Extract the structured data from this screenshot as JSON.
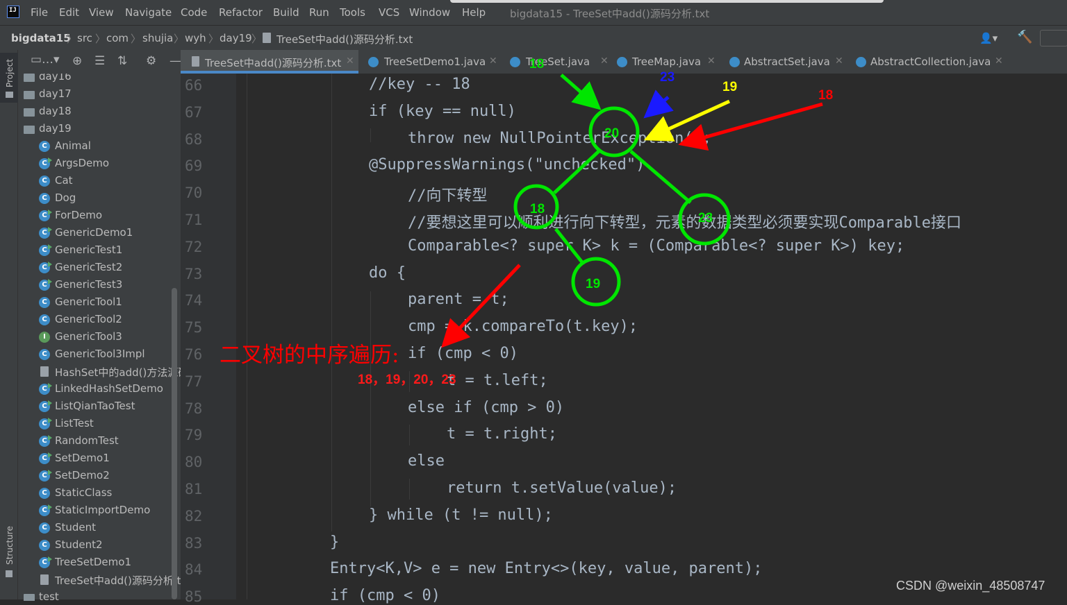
{
  "window": {
    "title": "bigdata15 - TreeSet中add()源码分析.txt",
    "menu": [
      "File",
      "Edit",
      "View",
      "Navigate",
      "Code",
      "Refactor",
      "Build",
      "Run",
      "Tools",
      "VCS",
      "Window",
      "Help"
    ]
  },
  "breadcrumb": [
    "bigdata15",
    "src",
    "com",
    "shujia",
    "wyh",
    "day19",
    "TreeSet中add()源码分析.txt"
  ],
  "tool_windows": {
    "project": "Project",
    "structure": "Structure"
  },
  "project_tree": {
    "folders": [
      "day16",
      "day17",
      "day18",
      "day19"
    ],
    "items": [
      {
        "label": "Animal",
        "kind": "class"
      },
      {
        "label": "ArgsDemo",
        "kind": "class-run"
      },
      {
        "label": "Cat",
        "kind": "class"
      },
      {
        "label": "Dog",
        "kind": "class"
      },
      {
        "label": "ForDemo",
        "kind": "class-run"
      },
      {
        "label": "GenericDemo1",
        "kind": "class-run"
      },
      {
        "label": "GenericTest1",
        "kind": "class-run"
      },
      {
        "label": "GenericTest2",
        "kind": "class-run"
      },
      {
        "label": "GenericTest3",
        "kind": "class-run"
      },
      {
        "label": "GenericTool1",
        "kind": "class"
      },
      {
        "label": "GenericTool2",
        "kind": "class"
      },
      {
        "label": "GenericTool3",
        "kind": "interface"
      },
      {
        "label": "GenericTool3Impl",
        "kind": "class"
      },
      {
        "label": "HashSet中的add()方法源码",
        "kind": "file"
      },
      {
        "label": "LinkedHashSetDemo",
        "kind": "class-run"
      },
      {
        "label": "ListQianTaoTest",
        "kind": "class-run"
      },
      {
        "label": "ListTest",
        "kind": "class-run"
      },
      {
        "label": "RandomTest",
        "kind": "class-run"
      },
      {
        "label": "SetDemo1",
        "kind": "class-run"
      },
      {
        "label": "SetDemo2",
        "kind": "class-run"
      },
      {
        "label": "StaticClass",
        "kind": "class"
      },
      {
        "label": "StaticImportDemo",
        "kind": "class-run"
      },
      {
        "label": "Student",
        "kind": "class"
      },
      {
        "label": "Student2",
        "kind": "class"
      },
      {
        "label": "TreeSetDemo1",
        "kind": "class-run"
      },
      {
        "label": "TreeSet中add()源码分析.t",
        "kind": "file"
      }
    ],
    "trailing_folder": "test"
  },
  "tabs": [
    {
      "label": "TreeSet中add()源码分析.txt",
      "icon": "text-file-icon",
      "active": true
    },
    {
      "label": "TreeSetDemo1.java",
      "icon": "class-icon"
    },
    {
      "label": "TreeSet.java",
      "icon": "class-icon"
    },
    {
      "label": "TreeMap.java",
      "icon": "class-icon"
    },
    {
      "label": "AbstractSet.java",
      "icon": "class-icon"
    },
    {
      "label": "AbstractCollection.java",
      "icon": "class-icon"
    }
  ],
  "code": {
    "line_numbers": [
      "66",
      "67",
      "68",
      "69",
      "70",
      "71",
      "72",
      "73",
      "74",
      "75",
      "76",
      "77",
      "78",
      "79",
      "80",
      "81",
      "82",
      "83",
      "84",
      "85"
    ],
    "lines": [
      "//key -- 18",
      "if (key == null)",
      "throw new NullPointerException();",
      "@SuppressWarnings(\"unchecked\")",
      "//向下转型",
      "//要想这里可以顺利进行向下转型，元素的数据类型必须要实现Comparable接口",
      "Comparable<? super K> k = (Comparable<? super K>) key;",
      "do {",
      "parent = t;",
      "cmp = k.compareTo(t.key);",
      "if (cmp < 0)",
      "t = t.left;",
      "else if (cmp > 0)",
      "t = t.right;",
      "else",
      "return t.setValue(value);",
      "} while (t != null);",
      "}",
      "Entry<K,V> e = new Entry<>(key, value, parent);",
      "if (cmp < 0)"
    ]
  },
  "annotations": {
    "tree_nodes": [
      "20",
      "18",
      "23",
      "19"
    ],
    "arrow_labels": [
      {
        "text": "18",
        "color": "#00dd00"
      },
      {
        "text": "23",
        "color": "#1a1aff"
      },
      {
        "text": "19",
        "color": "#ffff00"
      },
      {
        "text": "18",
        "color": "#ff0000"
      }
    ],
    "inorder_title": "二叉树的中序遍历:",
    "inorder_sequence": "18，19，20，23",
    "node_color": "#00e600"
  },
  "watermark": "CSDN @weixin_48508747"
}
